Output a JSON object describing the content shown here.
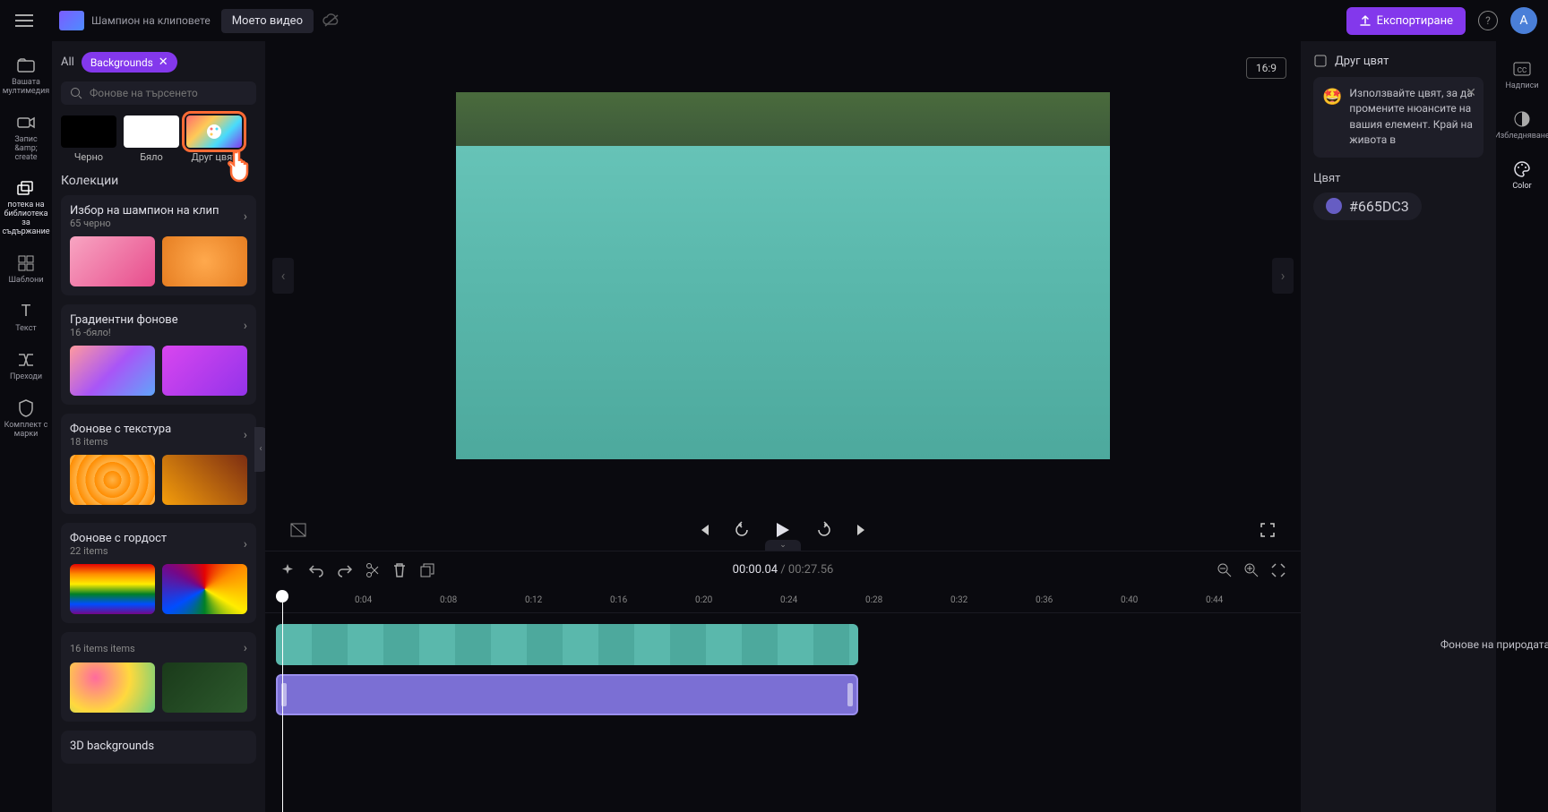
{
  "header": {
    "app_subtitle": "Шампион на клиповете",
    "project_name": "Моето видео",
    "export_label": "Експортиране",
    "avatar_initial": "A"
  },
  "left_rail": {
    "items": [
      {
        "label": "Вашата мултимедия"
      },
      {
        "label": "Запис &amp; create"
      },
      {
        "label": "потека на библиотека за съдържание"
      },
      {
        "label": "Шаблони"
      },
      {
        "label": "Текст"
      },
      {
        "label": "Преходи"
      },
      {
        "label": "Комплект с марки"
      }
    ]
  },
  "side_panel": {
    "filter_all": "All",
    "filter_chip": "Backgrounds",
    "search_placeholder": "Фонове на търсенето",
    "swatch_black": "Черно",
    "swatch_white": "Бяло",
    "swatch_custom": "Друг цвят",
    "collections_title": "Колекции",
    "collections": [
      {
        "title": "Избор на шампион на клип",
        "sub": "65 черно"
      },
      {
        "title": "Градиентни фонове",
        "sub": "16 -бяло!"
      },
      {
        "title": "Фонове с текстура",
        "sub": "18 items"
      },
      {
        "title": "Фонове с гордост",
        "sub": "22 items"
      },
      {
        "title": "",
        "sub": "16 items items"
      },
      {
        "title": "3D backgrounds",
        "sub": ""
      }
    ]
  },
  "preview": {
    "aspect": "16:9"
  },
  "playback": {
    "current": "00:00.04",
    "total": "00:27.56"
  },
  "ruler_ticks": [
    "0:04",
    "0:08",
    "0:12",
    "0:16",
    "0:20",
    "0:24",
    "0:28",
    "0:32",
    "0:36",
    "0:40",
    "0:44"
  ],
  "right_panel": {
    "title": "Друг цвят",
    "tip": "Използвайте цвят, за да промените нюансите на вашия елемент. Край на живота в",
    "color_label": "Цвят",
    "color_value": "#665DC3",
    "nature_label": "Фонове на природата"
  },
  "right_rail": {
    "items": [
      {
        "label": "Надписи"
      },
      {
        "label": "Избледняване"
      },
      {
        "label": "Color"
      }
    ]
  }
}
